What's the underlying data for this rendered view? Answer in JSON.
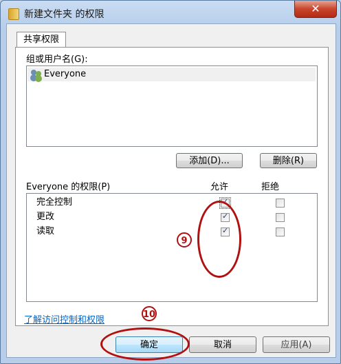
{
  "window": {
    "title": "新建文件夹 的权限",
    "close_glyph": "✕"
  },
  "tabs": [
    {
      "label": "共享权限"
    }
  ],
  "groups": {
    "label": "组或用户名(G):",
    "items": [
      {
        "name": "Everyone"
      }
    ]
  },
  "buttons": {
    "add": "添加(D)...",
    "remove": "删除(R)",
    "ok": "确定",
    "cancel": "取消",
    "apply": "应用(A)"
  },
  "permissions": {
    "header": "Everyone 的权限(P)",
    "allow_label": "允许",
    "deny_label": "拒绝",
    "rows": [
      {
        "name": "完全控制",
        "allow": true,
        "deny": false
      },
      {
        "name": "更改",
        "allow": true,
        "deny": false
      },
      {
        "name": "读取",
        "allow": true,
        "deny": false
      }
    ]
  },
  "help_link": "了解访问控制和权限",
  "annotations": {
    "step9": "9",
    "step10": "10",
    "color": "#b01010"
  }
}
